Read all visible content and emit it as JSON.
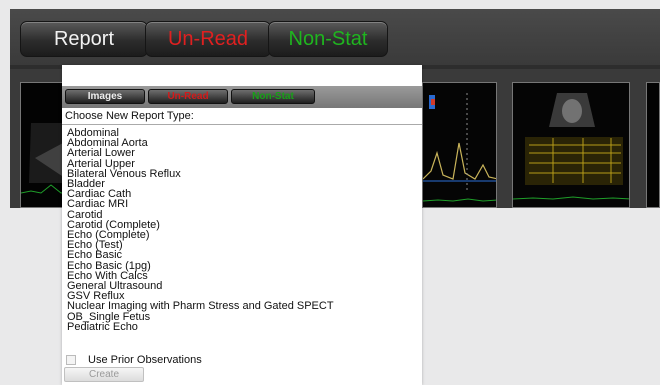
{
  "topbar": {
    "report_label": "Report",
    "unread_label": "Un-Read",
    "nonstat_label": "Non-Stat"
  },
  "panel": {
    "images_label": "Images",
    "unread_label": "Un-Read",
    "nonstat_label": "Non-Stat",
    "choose_label": "Choose New Report Type:",
    "report_types": [
      "Abdominal",
      "Abdominal Aorta",
      "Arterial Lower",
      "Arterial Upper",
      "Bilateral Venous Reflux",
      "Bladder",
      "Cardiac Cath",
      "Cardiac MRI",
      "Carotid",
      "Carotid (Complete)",
      "Echo (Complete)",
      "Echo (Test)",
      "Echo Basic",
      "Echo Basic (1pg)",
      "Echo With Calcs",
      "General Ultrasound",
      "GSV Reflux",
      "Nuclear Imaging with Pharm Stress and Gated SPECT",
      "OB_Single Fetus",
      "Pediatric Echo"
    ],
    "use_prior_label": "Use Prior Observations",
    "use_prior_checked": false,
    "create_label": "Create"
  },
  "colors": {
    "unread": "#e02020",
    "nonstat": "#1fb51f"
  }
}
